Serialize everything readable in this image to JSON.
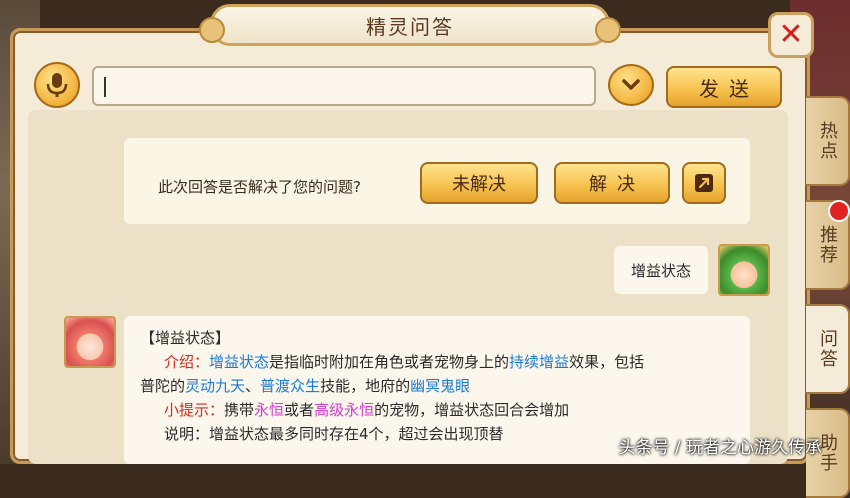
{
  "window": {
    "title": "精灵问答",
    "close_symbol": "✕"
  },
  "input": {
    "value": "",
    "send_label": "发送"
  },
  "tabs": [
    {
      "label": "热点",
      "active": false
    },
    {
      "label": "推荐",
      "active": false,
      "has_notification": true
    },
    {
      "label": "问答",
      "active": true
    },
    {
      "label": "助手",
      "active": false
    }
  ],
  "feedback": {
    "question": "此次回答是否解决了您的问题?",
    "unsolved_label": "未解决",
    "solved_label": "解决"
  },
  "user_message": {
    "text": "增益状态"
  },
  "bot_message": {
    "title": "【增益状态】",
    "intro_label": "介绍：",
    "intro_term": "增益状态",
    "intro_text1": "是指临时附加在角色或者宠物身上的",
    "intro_term2": "持续增益",
    "intro_text2": "效果，包括",
    "line2_text1": "普陀的",
    "skill1": "灵动九天",
    "sep1": "、",
    "skill2": "普渡众生",
    "line2_text2": "技能，地府的",
    "skill3": "幽冥鬼眼",
    "tip_label": "小提示：",
    "tip_text1": "携带",
    "tip_term1": "永恒",
    "tip_text2": "或者",
    "tip_term2": "高级永恒",
    "tip_text3": "的宠物，增益状态回合会增加",
    "note": "说明：增益状态最多同时存在4个，超过会出现顶替"
  },
  "watermark": "头条号 / 玩者之心游久传承",
  "colors": {
    "panel_bg": "#f4ecd8",
    "button_gold": "#f6c04c",
    "highlight_red": "#d42a1a",
    "highlight_blue": "#1b7ad6",
    "highlight_pink": "#d23ccf",
    "close_red": "#d61e1e"
  },
  "icons": {
    "mic": "microphone-icon",
    "dropdown": "chevron-down-icon",
    "share": "share-icon",
    "close": "close-icon"
  }
}
